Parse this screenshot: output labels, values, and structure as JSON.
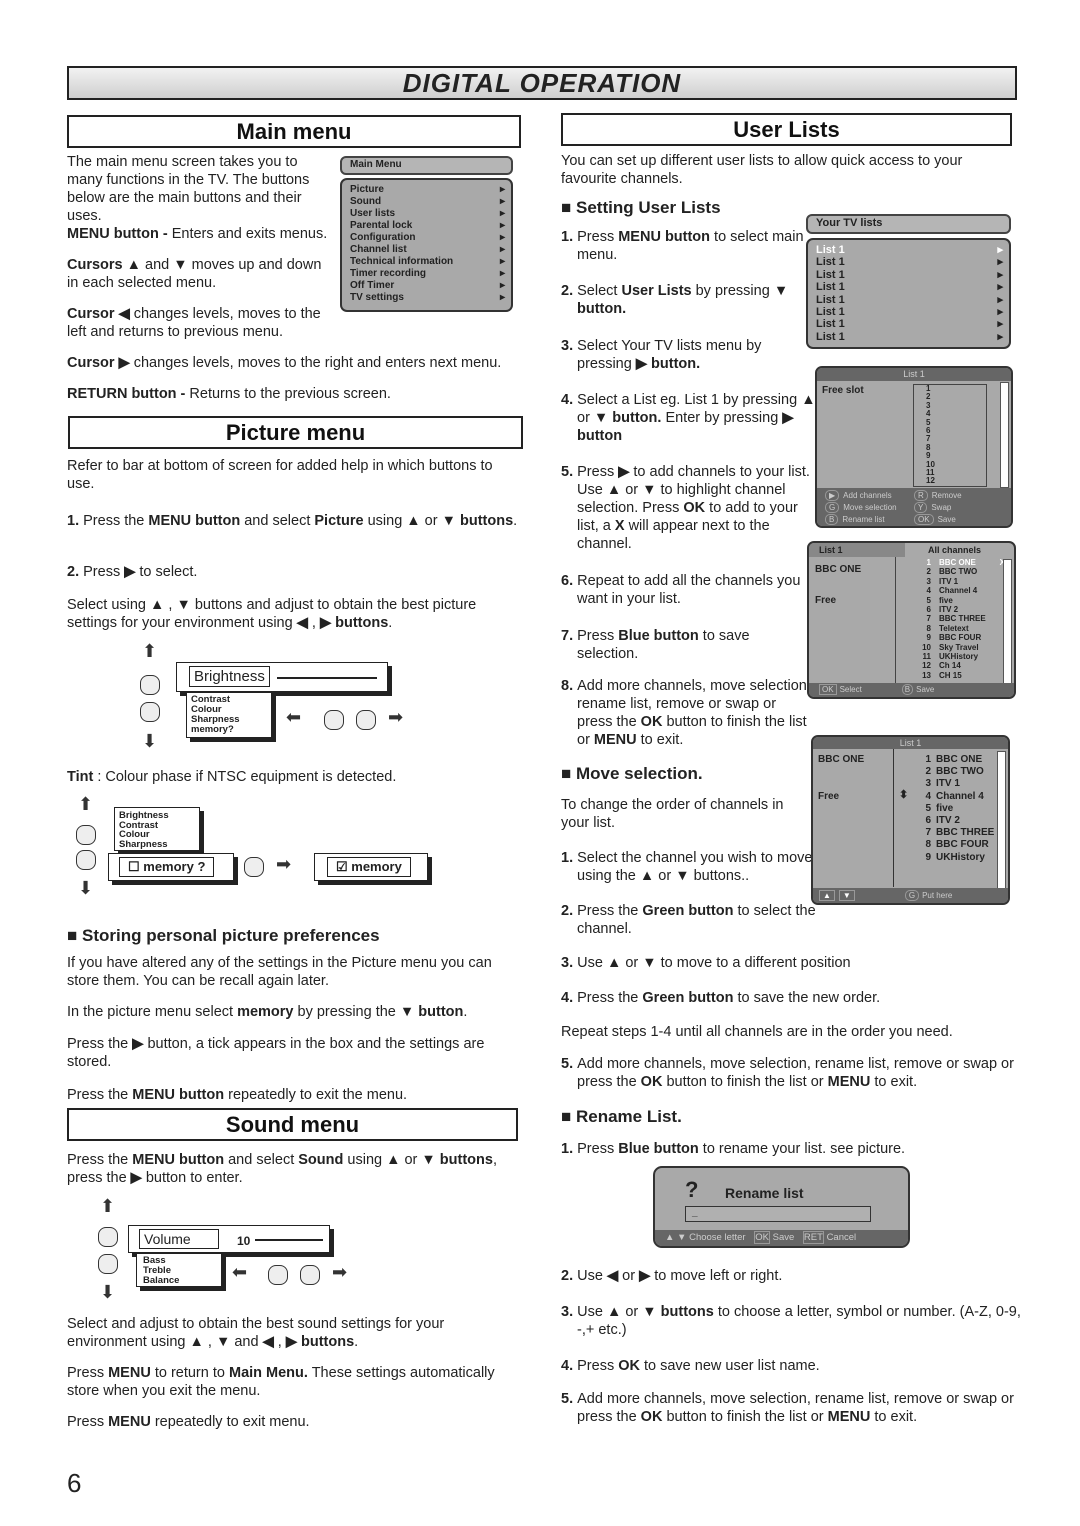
{
  "banner": "DIGITAL OPERATION",
  "left": {
    "main_menu_title": "Main menu",
    "intro": "The main menu screen takes you to many functions in the TV. The buttons below are the main buttons and their uses.",
    "menu_btn": [
      {
        "t": "MENU button - ",
        "b": true
      },
      {
        "t": "Enters and exits menus."
      }
    ],
    "cursors": [
      {
        "t": "Cursors ▲",
        "b": true
      },
      {
        "t": " and "
      },
      {
        "t": "▼",
        "b": true
      },
      {
        "t": " moves up and down in each selected menu."
      }
    ],
    "cursor_left": [
      {
        "t": "Cursor ◀",
        "b": true
      },
      {
        "t": "  changes levels, moves to the left and returns to previous menu."
      }
    ],
    "cursor_right": [
      {
        "t": "Cursor  ▶",
        "b": true
      },
      {
        "t": "  changes levels, moves to the right and enters next menu."
      }
    ],
    "return_btn": [
      {
        "t": "RETURN button - ",
        "b": true
      },
      {
        "t": "Returns to the previous screen."
      }
    ],
    "main_menu_screen": {
      "header": "Main Menu",
      "items": [
        "Picture",
        "Sound",
        "User lists",
        "Parental lock",
        "Configuration",
        "Channel list",
        "Technical information",
        "Timer recording",
        "Off Timer",
        "TV settings"
      ]
    },
    "picture_title": "Picture menu",
    "pic_p1": "Refer to bar at bottom of screen for added help in which buttons to use.",
    "pic_s1": [
      {
        "t": "1. ",
        "b": true
      },
      {
        "t": "Press the "
      },
      {
        "t": "MENU button",
        "b": true
      },
      {
        "t": " and select "
      },
      {
        "t": "Picture",
        "b": true
      },
      {
        "t": " using "
      },
      {
        "t": "▲",
        "b": true
      },
      {
        "t": "  or "
      },
      {
        "t": "▼",
        "b": true
      },
      {
        "t": " buttons",
        "b": true
      },
      {
        "t": "."
      }
    ],
    "pic_s2": [
      {
        "t": "2. ",
        "b": true
      },
      {
        "t": "Press "
      },
      {
        "t": "▶",
        "b": true
      },
      {
        "t": "  to select."
      }
    ],
    "pic_p2": [
      {
        "t": "Select using "
      },
      {
        "t": "▲",
        "b": true
      },
      {
        "t": " , "
      },
      {
        "t": "▼",
        "b": true
      },
      {
        "t": " buttons and adjust to obtain the best picture settings for your environment using  "
      },
      {
        "t": "◀",
        "b": true
      },
      {
        "t": " , "
      },
      {
        "t": "▶",
        "b": true
      },
      {
        "t": " buttons",
        "b": true
      },
      {
        "t": "."
      }
    ],
    "pic_diag": {
      "selected": "Brightness",
      "items": [
        "Contrast",
        "Colour",
        "Sharpness",
        "memory?"
      ]
    },
    "tint": [
      {
        "t": "Tint",
        "b": true
      },
      {
        "t": " : Colour phase if NTSC equipment is detected."
      }
    ],
    "mem_diag": {
      "items": [
        "Brightness",
        "Contrast",
        "Colour",
        "Sharpness"
      ],
      "memory_unchecked": "☐ memory ?",
      "memory_checked": "☑ memory"
    },
    "store_heading": "■ Storing personal picture preferences",
    "store_p1": "If you have altered any of the settings in the Picture menu you can store them. You can be recall again later.",
    "store_p2": [
      {
        "t": "In the picture menu select "
      },
      {
        "t": "memory",
        "b": true
      },
      {
        "t": " by pressing the "
      },
      {
        "t": "▼",
        "b": true
      },
      {
        "t": "  "
      },
      {
        "t": "button",
        "b": true
      },
      {
        "t": "."
      }
    ],
    "store_p3": [
      {
        "t": "Press the  "
      },
      {
        "t": "▶",
        "b": true
      },
      {
        "t": " button, a tick appears in the box and the settings are stored."
      }
    ],
    "store_p4": [
      {
        "t": "Press the "
      },
      {
        "t": "MENU button",
        "b": true
      },
      {
        "t": " repeatedly to exit the menu."
      }
    ],
    "sound_title": "Sound menu",
    "snd_p1": [
      {
        "t": "Press the "
      },
      {
        "t": "MENU button",
        "b": true
      },
      {
        "t": " and select "
      },
      {
        "t": "Sound",
        "b": true
      },
      {
        "t": " using "
      },
      {
        "t": "▲",
        "b": true
      },
      {
        "t": "  or "
      },
      {
        "t": "▼",
        "b": true
      },
      {
        "t": "  buttons",
        "b": true
      },
      {
        "t": ", press the "
      },
      {
        "t": "▶",
        "b": true
      },
      {
        "t": " button to enter."
      }
    ],
    "snd_diag": {
      "selected": "Volume",
      "value": "10",
      "items": [
        "Bass",
        "Treble",
        "Balance"
      ]
    },
    "snd_p2": [
      {
        "t": "Select and adjust to obtain the best sound settings for your environment using  "
      },
      {
        "t": "▲",
        "b": true
      },
      {
        "t": " , "
      },
      {
        "t": "▼",
        "b": true
      },
      {
        "t": " and "
      },
      {
        "t": "◀",
        "b": true
      },
      {
        "t": " , "
      },
      {
        "t": "▶",
        "b": true
      },
      {
        "t": "  buttons",
        "b": true
      },
      {
        "t": "."
      }
    ],
    "snd_p3": [
      {
        "t": "Press "
      },
      {
        "t": "MENU",
        "b": true
      },
      {
        "t": " to return to "
      },
      {
        "t": "Main Menu.",
        "b": true
      },
      {
        "t": " These settings automatically store when you exit the menu."
      }
    ],
    "snd_p4": [
      {
        "t": "Press "
      },
      {
        "t": "MENU",
        "b": true
      },
      {
        "t": " repeatedly to exit menu."
      }
    ],
    "page_number": "6"
  },
  "right": {
    "title": "User Lists",
    "intro": "You can set up different user lists to allow quick access to your favourite channels.",
    "setting_heading": "■ Setting User Lists",
    "s1": [
      {
        "t": "1. ",
        "b": true
      },
      {
        "t": "Press "
      },
      {
        "t": "MENU button",
        "b": true
      },
      {
        "t": " to select main menu."
      }
    ],
    "s2": [
      {
        "t": "2. ",
        "b": true
      },
      {
        "t": "Select "
      },
      {
        "t": "User Lists",
        "b": true
      },
      {
        "t": " by pressing "
      },
      {
        "t": "▼ button.",
        "b": true
      }
    ],
    "s3": [
      {
        "t": "3. ",
        "b": true
      },
      {
        "t": "Select Your TV lists menu by pressing "
      },
      {
        "t": "▶ button.",
        "b": true
      }
    ],
    "s4": [
      {
        "t": "4. ",
        "b": true
      },
      {
        "t": "Select a List eg. List 1 by pressing "
      },
      {
        "t": "▲",
        "b": true
      },
      {
        "t": " or "
      },
      {
        "t": "▼ button.",
        "b": true
      },
      {
        "t": " Enter by pressing "
      },
      {
        "t": "▶ button",
        "b": true
      }
    ],
    "s5": [
      {
        "t": "5. ",
        "b": true
      },
      {
        "t": "Press "
      },
      {
        "t": "▶",
        "b": true
      },
      {
        "t": "  to add channels to your list. Use "
      },
      {
        "t": "▲",
        "b": true
      },
      {
        "t": "  or "
      },
      {
        "t": "▼",
        "b": true
      },
      {
        "t": " to highlight channel selection. Press "
      },
      {
        "t": "OK",
        "b": true
      },
      {
        "t": " to add to your list, a "
      },
      {
        "t": "X",
        "b": true
      },
      {
        "t": " will appear next to the channel."
      }
    ],
    "s6": [
      {
        "t": "6. ",
        "b": true
      },
      {
        "t": "Repeat to add all the channels you want in your list."
      }
    ],
    "s7": [
      {
        "t": "7. ",
        "b": true
      },
      {
        "t": "Press "
      },
      {
        "t": "Blue button",
        "b": true
      },
      {
        "t": " to save selection."
      }
    ],
    "s8": [
      {
        "t": "8. ",
        "b": true
      },
      {
        "t": "Add more channels, move selection, rename list, remove or swap or press the "
      },
      {
        "t": "OK",
        "b": true
      },
      {
        "t": " button to finish the list or "
      },
      {
        "t": "MENU",
        "b": true
      },
      {
        "t": " to exit."
      }
    ],
    "tvlists": {
      "header": "Your TV lists",
      "items": [
        "List 1",
        "List 1",
        "List 1",
        "List 1",
        "List 1",
        "List 1",
        "List 1",
        "List 1"
      ]
    },
    "list1": {
      "header": "List 1",
      "label": "Free slot",
      "numbers": [
        "1",
        "2",
        "3",
        "4",
        "5",
        "6",
        "7",
        "8",
        "9",
        "10",
        "11",
        "12"
      ],
      "help": [
        "Add channels",
        "Remove",
        "Move selection",
        "Swap",
        "Rename list",
        "Save"
      ],
      "keys": [
        "▶",
        "R",
        "G",
        "Y",
        "B",
        "OK"
      ]
    },
    "allch": {
      "tab_left": "List 1",
      "tab_right": "All channels",
      "left_items": [
        "BBC ONE",
        "Free"
      ],
      "numbers": [
        "1",
        "2",
        "3",
        "4",
        "5",
        "6",
        "7",
        "8",
        "9",
        "10",
        "11",
        "12",
        "13"
      ],
      "channels": [
        "BBC ONE",
        "BBC TWO",
        "ITV 1",
        "Channel 4",
        "five",
        "ITV 2",
        "BBC THREE",
        "Teletext",
        "BBC FOUR",
        "Sky Travel",
        "UKHistory",
        "Ch 14",
        "CH 15"
      ],
      "mark": "X",
      "footer_select": "Select",
      "footer_save": "Save",
      "key_ok": "OK",
      "key_b": "B"
    },
    "move_heading": "■ Move selection.",
    "move_p": "To change the order of channels in your list.",
    "m1": [
      {
        "t": "1. ",
        "b": true
      },
      {
        "t": "Select the channel you wish to move using the "
      },
      {
        "t": "▲",
        "b": true
      },
      {
        "t": " or "
      },
      {
        "t": "▼",
        "b": true
      },
      {
        "t": " buttons.."
      }
    ],
    "m2": [
      {
        "t": "2. ",
        "b": true
      },
      {
        "t": "Press the "
      },
      {
        "t": "Green button",
        "b": true
      },
      {
        "t": " to select the channel."
      }
    ],
    "m3": [
      {
        "t": "3. ",
        "b": true
      },
      {
        "t": "Use "
      },
      {
        "t": "▲",
        "b": true
      },
      {
        "t": "  or "
      },
      {
        "t": "▼",
        "b": true
      },
      {
        "t": " to move to a different position"
      }
    ],
    "m4": [
      {
        "t": "4. ",
        "b": true
      },
      {
        "t": "Press the "
      },
      {
        "t": "Green button",
        "b": true
      },
      {
        "t": " to save the new order."
      }
    ],
    "m_repeat": "Repeat steps 1-4 until all channels are in the order you need.",
    "m5": [
      {
        "t": "5. ",
        "b": true
      },
      {
        "t": "Add more channels, move selection, rename list, remove or swap or press the "
      },
      {
        "t": "OK",
        "b": true
      },
      {
        "t": " button to finish the list or "
      },
      {
        "t": "MENU",
        "b": true
      },
      {
        "t": " to exit."
      }
    ],
    "move_screen": {
      "header": "List 1",
      "left_items": [
        "BBC ONE",
        "Free"
      ],
      "numbers": [
        "1",
        "2",
        "3",
        "4",
        "5",
        "6",
        "7",
        "8",
        "9"
      ],
      "channels": [
        "BBC ONE",
        "BBC TWO",
        "ITV 1",
        "Channel 4",
        "five",
        "ITV 2",
        "BBC THREE",
        "BBC FOUR",
        "UKHistory"
      ],
      "footer": "Put here",
      "key_g": "G"
    },
    "rename_heading": "■ Rename List.",
    "r1": [
      {
        "t": "1. ",
        "b": true
      },
      {
        "t": "Press "
      },
      {
        "t": "Blue button",
        "b": true
      },
      {
        "t": " to rename your list. see picture."
      }
    ],
    "rename_dialog": {
      "icon": "?",
      "title": "Rename list",
      "value": "_",
      "help": [
        "Choose letter",
        "Save",
        "Cancel"
      ],
      "keys": [
        "OK",
        "RET"
      ]
    },
    "r2": [
      {
        "t": "2. ",
        "b": true
      },
      {
        "t": "Use "
      },
      {
        "t": "◀",
        "b": true
      },
      {
        "t": "  or  "
      },
      {
        "t": "▶",
        "b": true
      },
      {
        "t": "  to move left or right."
      }
    ],
    "r3": [
      {
        "t": "3. ",
        "b": true
      },
      {
        "t": "Use "
      },
      {
        "t": "▲",
        "b": true
      },
      {
        "t": "  or  "
      },
      {
        "t": "▼",
        "b": true
      },
      {
        "t": "  buttons",
        "b": true
      },
      {
        "t": " to choose a letter, symbol or number. (A-Z, 0-9, -,+ etc.)"
      }
    ],
    "r4": [
      {
        "t": "4. ",
        "b": true
      },
      {
        "t": "Press "
      },
      {
        "t": "OK",
        "b": true
      },
      {
        "t": " to save new user list name."
      }
    ],
    "r5": [
      {
        "t": "5. ",
        "b": true
      },
      {
        "t": "Add more channels, move selection, rename list, remove or swap or press the "
      },
      {
        "t": "OK",
        "b": true
      },
      {
        "t": " button to finish the list or "
      },
      {
        "t": "MENU",
        "b": true
      },
      {
        "t": " to exit."
      }
    ]
  }
}
